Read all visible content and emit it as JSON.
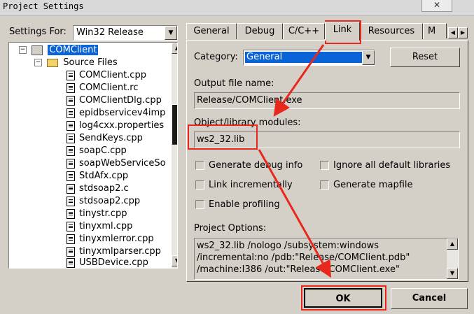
{
  "window": {
    "title": "Project Settings",
    "close_label": "✕"
  },
  "settings_for": {
    "label": "Settings For:",
    "value": "Win32 Release"
  },
  "tree": {
    "project": "COMClient",
    "folder": "Source Files",
    "files": [
      "COMClient.cpp",
      "COMClient.rc",
      "COMClientDlg.cpp",
      "epidbservicev4imp",
      "log4cxx.properties",
      "SendKeys.cpp",
      "soapC.cpp",
      "soapWebServiceSo",
      "StdAfx.cpp",
      "stdsoap2.c",
      "stdsoap2.cpp",
      "tinystr.cpp",
      "tinyxml.cpp",
      "tinyxmlerror.cpp",
      "tinyxmlparser.cpp",
      "USBDevice.cpp"
    ]
  },
  "tabs": [
    "General",
    "Debug",
    "C/C++",
    "Link",
    "Resources",
    "M"
  ],
  "active_tab": "Link",
  "category": {
    "label": "Category:",
    "value": "General"
  },
  "reset_label": "Reset",
  "output_file": {
    "label": "Output file name:",
    "value": "Release/COMClient.exe"
  },
  "object_modules": {
    "label": "Object/library modules:",
    "value": "ws2_32.lib"
  },
  "checkboxes": {
    "debug_info": "Generate debug info",
    "ignore_libs": "Ignore all default libraries",
    "link_incr": "Link incrementally",
    "mapfile": "Generate mapfile",
    "profiling": "Enable profiling"
  },
  "project_options": {
    "label": "Project Options:",
    "line1": "ws2_32.lib /nologo /subsystem:windows",
    "line2": "/incremental:no /pdb:\"Release/COMClient.pdb\"",
    "line3": "/machine:I386 /out:\"Release/COMClient.exe\""
  },
  "ok_label": "OK",
  "cancel_label": "Cancel",
  "colors": {
    "annotation": "#e8281c",
    "selection": "#0a64d8",
    "face": "#d4d0c8"
  }
}
